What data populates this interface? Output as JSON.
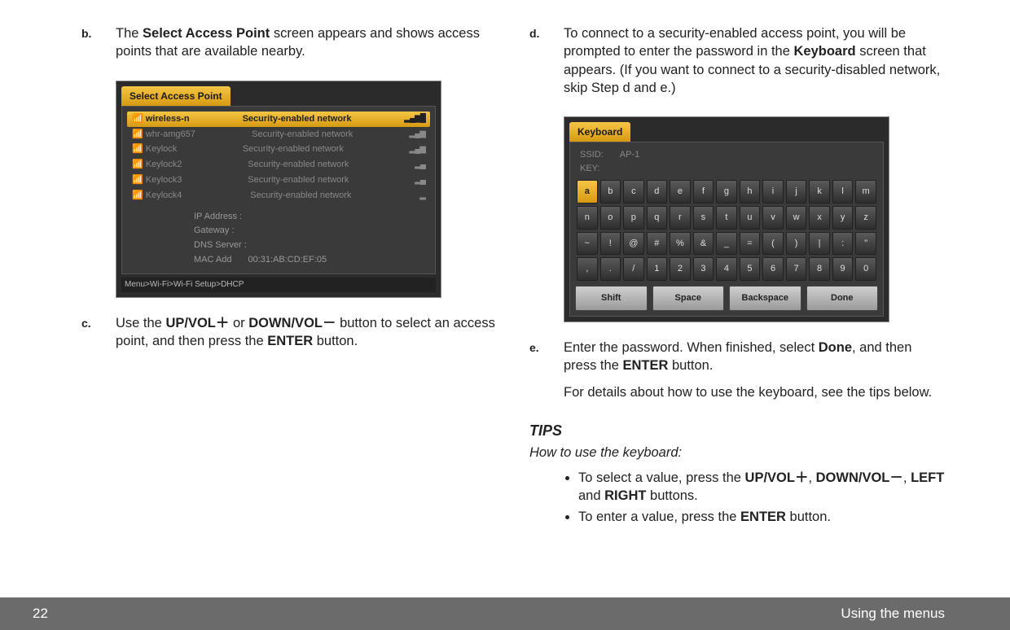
{
  "footer": {
    "page": "22",
    "section": "Using the menus"
  },
  "left": {
    "b": {
      "letter": "b.",
      "t1": "The ",
      "bold1": "Select Access Point",
      "t2": " screen appears and shows access points that are available nearby."
    },
    "c": {
      "letter": "c.",
      "t1": "Use the ",
      "bold1": "UP/VOL＋",
      "t2": " or ",
      "bold2": "DOWN/VOL－",
      "t3": " button to select an access point, and then press the ",
      "bold3": "ENTER",
      "t4": " button."
    }
  },
  "right": {
    "d": {
      "letter": "d.",
      "t1": "To connect to a security-enabled access point, you will be prompted to enter the password in the ",
      "bold1": "Keyboard",
      "t2": " screen that appears. (If you want to connect to a security-disabled network, skip Step d and e.)"
    },
    "e": {
      "letter": "e.",
      "t1": "Enter the password. When finished, select ",
      "bold1": "Done",
      "t2": ", and then press the ",
      "bold2": "ENTER",
      "t3": " button.",
      "para2": "For details about how to use the keyboard, see the tips below."
    },
    "tips_hd": "TIPS",
    "tips_sub": "How to use the keyboard:",
    "tip1": {
      "t1": "To select a value, press the ",
      "b1": "UP/VOL＋",
      "t2": ", ",
      "b2": "DOWN/VOL－",
      "t3": ", ",
      "b3": "LEFT",
      "t4": " and ",
      "b4": "RIGHT",
      "t5": " buttons."
    },
    "tip2": {
      "t1": "To enter a value, press the ",
      "b1": "ENTER",
      "t2": " button."
    }
  },
  "scr1": {
    "title": "Select Access Point",
    "rows": [
      {
        "name": "wireless-n",
        "sec": "Security-enabled  network",
        "sel": true
      },
      {
        "name": "whr-amg657",
        "sec": "Security-enabled network"
      },
      {
        "name": "Keylock",
        "sec": "Security-enabled network"
      },
      {
        "name": "Keylock2",
        "sec": "Security-enabled network"
      },
      {
        "name": "Keylock3",
        "sec": "Security-enabled network"
      },
      {
        "name": "Keylock4",
        "sec": "Security-enabled network"
      }
    ],
    "info": {
      "ip": "IP Address :",
      "gw": "Gateway :",
      "dns": "DNS Server :",
      "mac_l": "MAC Add",
      "mac_v": "00:31:AB:CD:EF:05"
    },
    "bc": "Menu>Wi-Fi>Wi-Fi Setup>DHCP"
  },
  "scr2": {
    "title": "Keyboard",
    "ssid_l": "SSID:",
    "ssid_v": "AP-1",
    "key_l": "KEY:",
    "rows": [
      [
        "a",
        "b",
        "c",
        "d",
        "e",
        "f",
        "g",
        "h",
        "i",
        "j",
        "k",
        "l",
        "m"
      ],
      [
        "n",
        "o",
        "p",
        "q",
        "r",
        "s",
        "t",
        "u",
        "v",
        "w",
        "x",
        "y",
        "z"
      ],
      [
        "~",
        "!",
        "@",
        "#",
        "%",
        "&",
        "_",
        "=",
        "(",
        ")",
        "|",
        ":",
        "\""
      ],
      [
        ",",
        ".",
        "/",
        "1",
        "2",
        "3",
        "4",
        "5",
        "6",
        "7",
        "8",
        "9",
        "0"
      ]
    ],
    "wide": [
      "Shift",
      "Space",
      "Backspace",
      "Done"
    ]
  }
}
